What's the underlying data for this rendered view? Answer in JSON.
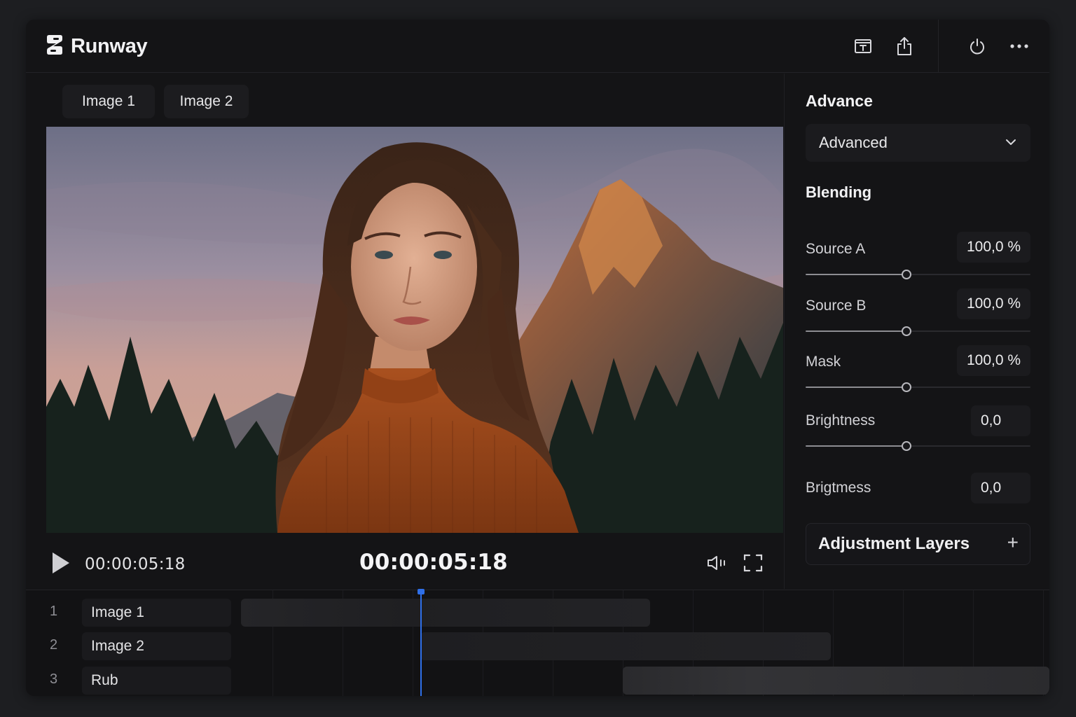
{
  "app": {
    "title": "Runway"
  },
  "header": {
    "icons": [
      "text-box-icon",
      "share-icon",
      "power-icon",
      "more-icon"
    ]
  },
  "tabs": [
    {
      "label": "Image 1"
    },
    {
      "label": "Image 2"
    }
  ],
  "playback": {
    "timecode_small": "00:00:05:18",
    "timecode_big": "00:00:05:18"
  },
  "sidebar": {
    "heading": "Advance",
    "dropdown_value": "Advanced",
    "blending_heading": "Blending",
    "params": [
      {
        "label": "Source A",
        "value": "100,0 %",
        "slider": 0.45
      },
      {
        "label": "Source B",
        "value": "100,0 %",
        "slider": 0.45
      },
      {
        "label": "Mask",
        "value": "100,0 %",
        "slider": 0.45
      },
      {
        "label": "Brightness",
        "value": "0,0",
        "slider": 0.45
      },
      {
        "label": "Brigtmess",
        "value": "0,0"
      }
    ],
    "adjustment_layers": "Adjustment Layers",
    "adjustment_add": "+"
  },
  "timeline": {
    "tracks": [
      {
        "num": "1",
        "label": "Image 1"
      },
      {
        "num": "2",
        "label": "Image 2"
      },
      {
        "num": "3",
        "label": "Rub"
      }
    ]
  },
  "colors": {
    "accent": "#2f6fe8",
    "background": "#141416",
    "panel": "#1b1b1e"
  }
}
